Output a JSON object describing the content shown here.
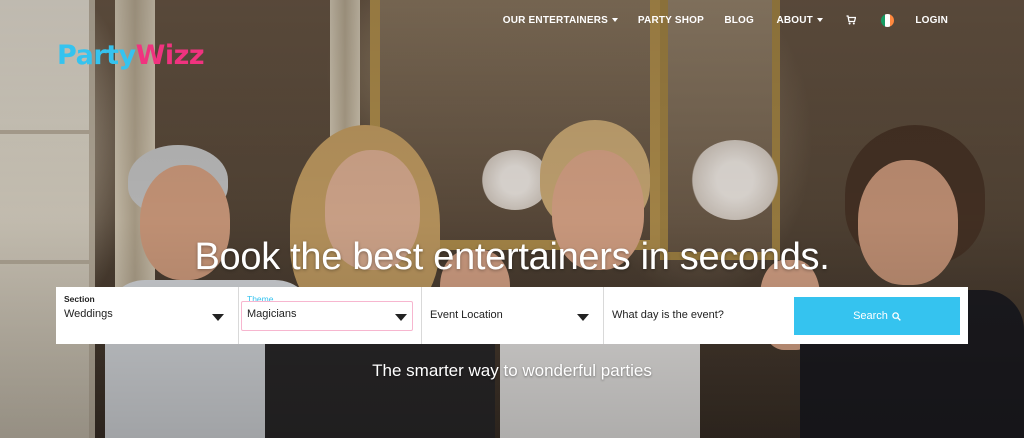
{
  "brand": {
    "part1": "Party",
    "part2": "Wizz"
  },
  "nav": {
    "items": [
      {
        "label": "OUR ENTERTAINERS",
        "dropdown": true
      },
      {
        "label": "PARTY SHOP",
        "dropdown": false
      },
      {
        "label": "BLOG",
        "dropdown": false
      },
      {
        "label": "ABOUT",
        "dropdown": true
      }
    ],
    "cart_icon": "cart-icon",
    "flag_icon": "ireland-flag-icon",
    "login_label": "LOGIN"
  },
  "hero": {
    "headline": "Book the best entertainers in seconds.",
    "tagline": "The smarter way to wonderful parties"
  },
  "search": {
    "section": {
      "label": "Section",
      "value": "Weddings"
    },
    "theme": {
      "label": "Theme",
      "value": "Magicians"
    },
    "location": {
      "placeholder": "Event Location"
    },
    "date": {
      "placeholder": "What day is the event?"
    },
    "button_label": "Search"
  },
  "colors": {
    "accent_blue": "#35c3ef",
    "accent_pink": "#f0337f",
    "flag_green": "#169b62",
    "flag_white": "#ffffff",
    "flag_orange": "#ff883e"
  }
}
